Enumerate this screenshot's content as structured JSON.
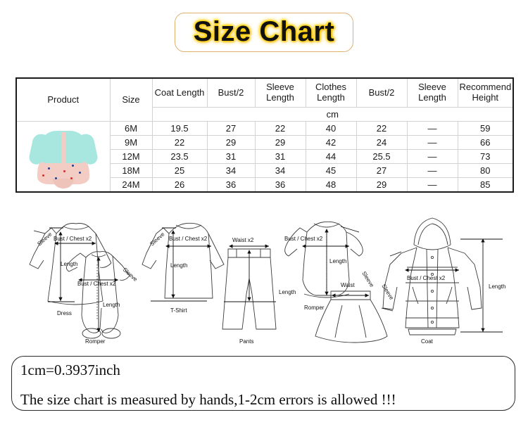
{
  "title": {
    "text": "Size Chart",
    "glow_color": "#ffd000",
    "border_color": "#e0b070"
  },
  "table": {
    "headers": [
      "Product",
      "Size",
      "Coat Length",
      "Bust/2",
      "Sleeve Length",
      "Clothes Length",
      "Bust/2",
      "Sleeve Length",
      "Recommend Height"
    ],
    "unit_row": "cm",
    "rows": [
      {
        "size": "6M",
        "coat_length": "19.5",
        "bust2_a": "27",
        "sleeve_length_a": "22",
        "clothes_length": "40",
        "bust2_b": "22",
        "sleeve_length_b": "—",
        "recommend_height": "59"
      },
      {
        "size": "9M",
        "coat_length": "22",
        "bust2_a": "29",
        "sleeve_length_a": "29",
        "clothes_length": "42",
        "bust2_b": "24",
        "sleeve_length_b": "—",
        "recommend_height": "66"
      },
      {
        "size": "12M",
        "coat_length": "23.5",
        "bust2_a": "31",
        "sleeve_length_a": "31",
        "clothes_length": "44",
        "bust2_b": "25.5",
        "sleeve_length_b": "—",
        "recommend_height": "73"
      },
      {
        "size": "18M",
        "coat_length": "25",
        "bust2_a": "34",
        "sleeve_length_a": "34",
        "clothes_length": "45",
        "bust2_b": "27",
        "sleeve_length_b": "—",
        "recommend_height": "80"
      },
      {
        "size": "24M",
        "coat_length": "26",
        "bust2_a": "36",
        "sleeve_length_a": "36",
        "clothes_length": "48",
        "bust2_b": "29",
        "sleeve_length_b": "—",
        "recommend_height": "85"
      }
    ],
    "product_image": {
      "description": "baby girl mint cardigan over pink polka dot dress",
      "cardigan_color": "#a8e6e0",
      "dress_color": "#f3cdc4"
    }
  },
  "diagrams": {
    "labels": {
      "sleeve": "Sleeve",
      "bust_chest": "Bust / Chest x2",
      "length": "Length",
      "waist": "Waist",
      "waist_x2": "Waist x2"
    },
    "garments": [
      {
        "name": "Dress"
      },
      {
        "name": "Romper"
      },
      {
        "name": "T-Shirt"
      },
      {
        "name": "Pants"
      },
      {
        "name": "Romper"
      },
      {
        "name": "Dress"
      },
      {
        "name": "Coat"
      }
    ]
  },
  "footer": {
    "line1": "1cm=0.3937inch",
    "line2": "The size chart is measured by hands,1-2cm errors is allowed !!!"
  }
}
